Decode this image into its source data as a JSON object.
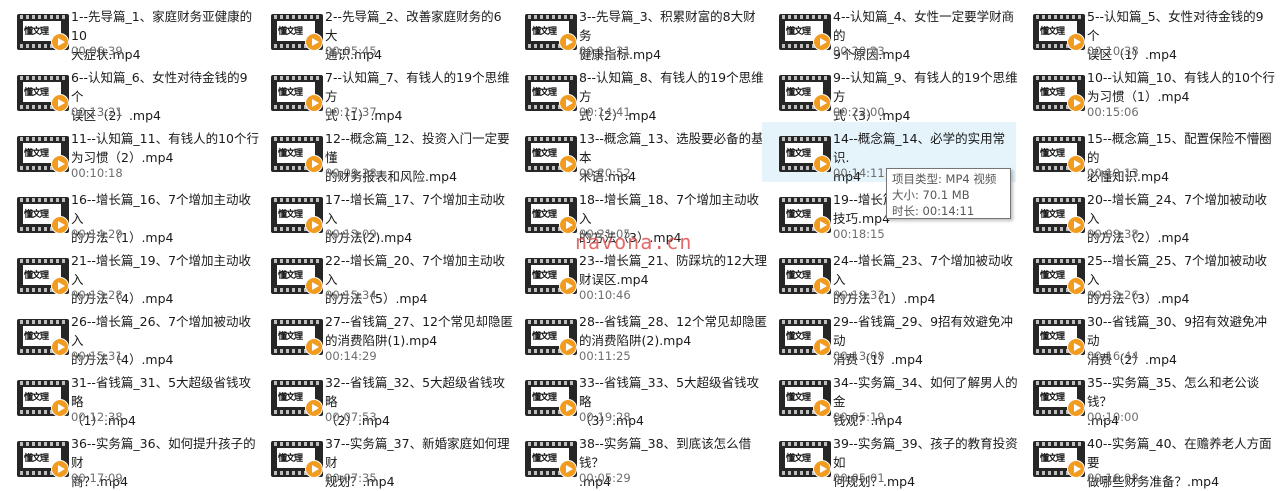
{
  "thumbnail_brand": "懂文理",
  "watermark": "navona.cn",
  "files": [
    {
      "name": "1--先导篇_1、家庭财务亚健康的10\n大症状.mp4",
      "duration": "00:06:39"
    },
    {
      "name": "2--先导篇_2、改善家庭财务的6大\n通识.mp4",
      "duration": "00:05:45"
    },
    {
      "name": "3--先导篇_3、积累财富的8大财务\n健康指标.mp4",
      "duration": "00:12:31"
    },
    {
      "name": "4--认知篇_4、女性一定要学财商的\n9个原因.mp4",
      "duration": "00:20:23"
    },
    {
      "name": "5--认知篇_5、女性对待金钱的9个\n误区（1）.mp4",
      "duration": "00:10:38"
    },
    {
      "name": "6--认知篇_6、女性对待金钱的9个\n误区（2）.mp4",
      "duration": "00:13:21"
    },
    {
      "name": "7--认知篇_7、有钱人的19个思维方\n式（1）.mp4",
      "duration": "00:17:37"
    },
    {
      "name": "8--认知篇_8、有钱人的19个思维方\n式（2）.mp4",
      "duration": "00:14:41"
    },
    {
      "name": "9--认知篇_9、有钱人的19个思维方\n式（3）.mp4",
      "duration": "00:22:00"
    },
    {
      "name": "10--认知篇_10、有钱人的10个行\n为习惯（1）.mp4",
      "duration": "00:15:06"
    },
    {
      "name": "11--认知篇_11、有钱人的10个行\n为习惯（2）.mp4",
      "duration": "00:10:18"
    },
    {
      "name": "12--概念篇_12、投资入门一定要懂\n的财务报表和风险.mp4",
      "duration": "00:09:28"
    },
    {
      "name": "13--概念篇_13、选股要必备的基本\n术语.mp4",
      "duration": "00:20:52"
    },
    {
      "name": "14--概念篇_14、必学的实用常识.\nmp4",
      "duration": "00:14:11"
    },
    {
      "name": "15--概念篇_15、配置保险不懵圈的\n必懂知识.mp4",
      "duration": "00:19:13"
    },
    {
      "name": "16--增长篇_16、7个增加主动收入\n的方法（1）.mp4",
      "duration": "00:14:29"
    },
    {
      "name": "17--增长篇_17、7个增加主动收入\n的方法(2).mp4",
      "duration": "00:13:09"
    },
    {
      "name": "18--增长篇_18、7个增加主动收入\n的方法（3）.mp4",
      "duration": "00:21:05"
    },
    {
      "name": "19--增长篇\n技巧.mp4",
      "duration": "00:18:15"
    },
    {
      "name": "20--增长篇_24、7个增加被动收入\n的方法（2）.mp4",
      "duration": "00:09:38"
    },
    {
      "name": "21--增长篇_19、7个增加主动收入\n的方法（4）.mp4",
      "duration": "00:13:28"
    },
    {
      "name": "22--增长篇_20、7个增加主动收入\n的方法（5）.mp4",
      "duration": "00:15:34"
    },
    {
      "name": "23--增长篇_21、防踩坑的12大理\n财误区.mp4",
      "duration": "00:10:46"
    },
    {
      "name": "24--增长篇_23、7个增加被动收入\n的方法（1）.mp4",
      "duration": "00:19:33"
    },
    {
      "name": "25--增长篇_25、7个增加被动收入\n的方法（3）.mp4",
      "duration": "00:12:26"
    },
    {
      "name": "26--增长篇_26、7个增加被动收入\n的方法（4）.mp4",
      "duration": "00:15:31"
    },
    {
      "name": "27--省钱篇_27、12个常见却隐匿\n的消费陷阱(1).mp4",
      "duration": "00:14:29"
    },
    {
      "name": "28--省钱篇_28、12个常见却隐匿\n的消费陷阱(2).mp4",
      "duration": "00:11:25"
    },
    {
      "name": "29--省钱篇_29、9招有效避免冲动\n消费（1）.mp4",
      "duration": "00:13:08"
    },
    {
      "name": "30--省钱篇_30、9招有效避免冲动\n消费（2）.mp4",
      "duration": "00:16:44"
    },
    {
      "name": "31--省钱篇_31、5大超级省钱攻略\n（1）.mp4",
      "duration": "00:12:38"
    },
    {
      "name": "32--省钱篇_32、5大超级省钱攻略\n（2）.mp4",
      "duration": "00:07:53"
    },
    {
      "name": "33--省钱篇_33、5大超级省钱攻略\n（3）.mp4",
      "duration": "00:19:28"
    },
    {
      "name": "34--实务篇_34、如何了解男人的金\n钱观？.mp4",
      "duration": "00:05:19"
    },
    {
      "name": "35--实务篇_35、怎么和老公谈钱？\n.mp4",
      "duration": "00:10:00"
    },
    {
      "name": "36--实务篇_36、如何提升孩子的财\n商？.mp4",
      "duration": "00:17:09"
    },
    {
      "name": "37--实务篇_37、新婚家庭如何理财\n规划？.mp4",
      "duration": "00:07:35"
    },
    {
      "name": "38--实务篇_38、到底该怎么借钱？\n.mp4",
      "duration": "00:05:29"
    },
    {
      "name": "39--实务篇_39、孩子的教育投资如\n何规划？.mp4",
      "duration": "00:05:01"
    },
    {
      "name": "40--实务篇_40、在赡养老人方面要\n做哪些财务准备？.mp4",
      "duration": "00:16:08"
    }
  ],
  "selected_index": 13,
  "tooltip": {
    "type_line": "项目类型: MP4 视频",
    "size_line": "大小: 70.1 MB",
    "duration_line": "时长: 00:14:11"
  }
}
